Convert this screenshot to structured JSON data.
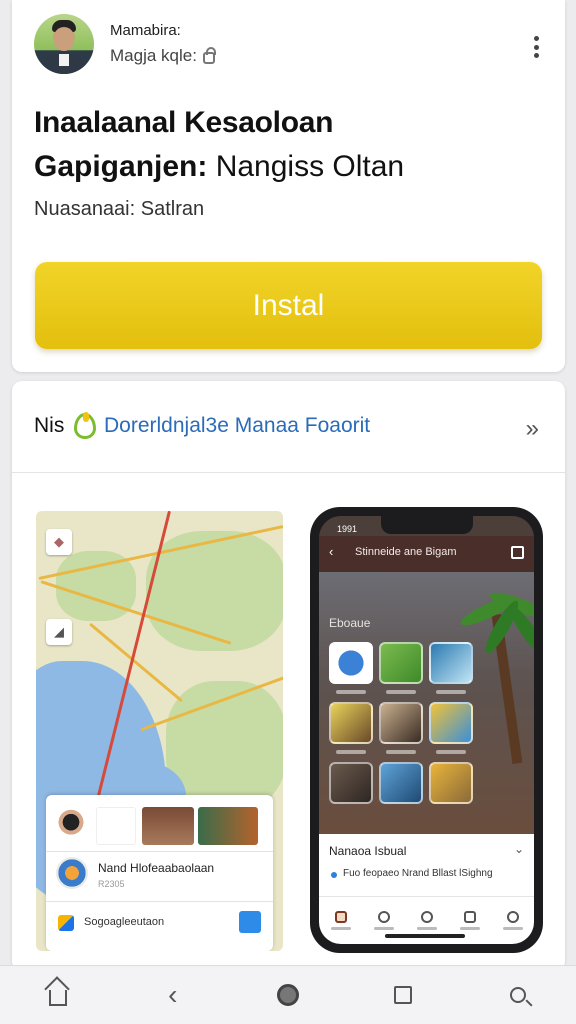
{
  "header": {
    "user_name": "Mamabira:",
    "user_sub": "Magja kqle:"
  },
  "app": {
    "title_line1": "Inaalaanal Kesaoloan",
    "title_line2_bold": "Gapiganjen:",
    "title_line2_rest": " Nangiss Oltan",
    "subtitle": "Nuasanaai: Satlran",
    "install_label": "Instal"
  },
  "promo": {
    "prefix": "Nis",
    "link": "Dorerldnjal3e Manaa Foaorit"
  },
  "map_panel": {
    "title": "Nand Hlofeaabaolaan",
    "sub": "R2305",
    "footer": "Sogoagleeutaon"
  },
  "phone": {
    "status_time": "1991",
    "header_title": "Stinneide ane Bigam",
    "section_label": "Eboaue",
    "sheet_title": "Nanaoa Isbual",
    "sheet_line": "Fuo feopaeo Nrand Bllast lSighng"
  },
  "icons": {
    "more": "more-vert-icon",
    "lock": "lock-icon",
    "chevron": "double-chevron-right-icon",
    "nav": [
      "home-icon",
      "back-icon",
      "circle-home-icon",
      "recents-icon",
      "search-icon"
    ]
  },
  "colors": {
    "install_button": "#e6c312",
    "link": "#2b6cb8",
    "accent_leaf": "#7cbd2f"
  }
}
